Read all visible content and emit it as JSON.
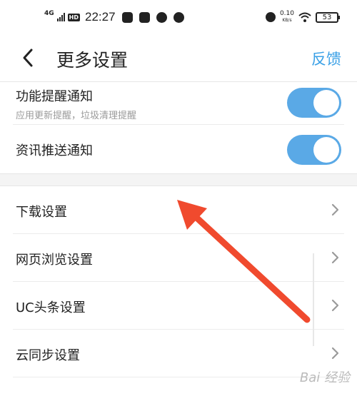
{
  "status_bar": {
    "network": "4G",
    "hd": "HD",
    "time": "22:27",
    "speed_value": "0.10",
    "speed_unit": "KB/s",
    "battery": "53"
  },
  "header": {
    "title": "更多设置",
    "feedback": "反馈"
  },
  "notifications": [
    {
      "title": "功能提醒通知",
      "subtitle": "应用更新提醒，垃圾清理提醒",
      "enabled": true
    },
    {
      "title": "资讯推送通知",
      "enabled": true
    }
  ],
  "settings_list": [
    {
      "label": "下载设置"
    },
    {
      "label": "网页浏览设置"
    },
    {
      "label": "UC头条设置"
    },
    {
      "label": "云同步设置"
    }
  ],
  "watermark": "Bai 经验",
  "colors": {
    "accent": "#3aa0e6",
    "toggle_on": "#5aa9e6",
    "annotation_arrow": "#f04a2e"
  }
}
